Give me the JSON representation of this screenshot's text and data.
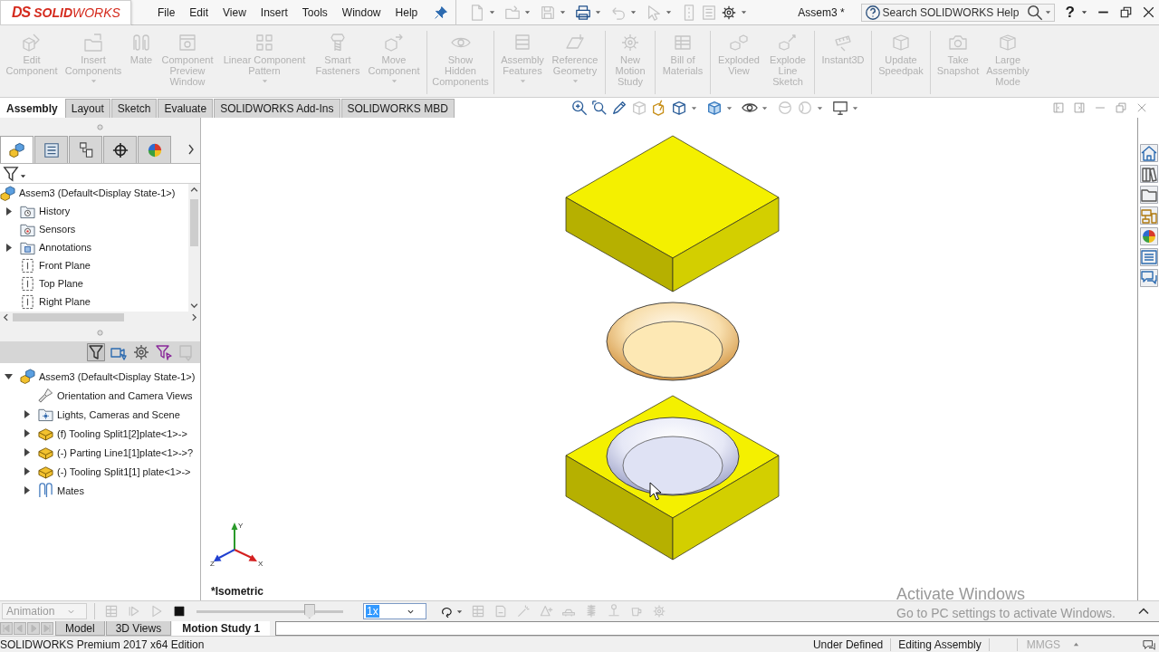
{
  "title_bar": {
    "logo_mark": "DS",
    "logo": "**SOLID**WORKS",
    "menu": [
      "File",
      "Edit",
      "View",
      "Insert",
      "Tools",
      "Window",
      "Help"
    ],
    "quick_access": [
      {
        "disabled": true
      },
      {
        "disabled": true
      },
      {
        "disabled": true
      },
      {
        "disabled": false
      },
      {
        "disabled": true
      },
      {
        "disabled": true
      },
      {
        "disabled": true
      },
      {
        "disabled": true
      },
      {
        "disabled": false
      }
    ],
    "document_title": "Assem3 *",
    "search": {
      "placeholder": "Search SOLIDWORKS Help"
    },
    "help_button": "?"
  },
  "command_manager": [
    {
      "buttons": [
        {
          "label": "Edit Component",
          "disabled": true,
          "dropdown": false
        },
        {
          "label": "Insert Components",
          "disabled": true,
          "dropdown": true
        },
        {
          "label": "Mate",
          "disabled": true,
          "dropdown": false
        },
        {
          "label": "Component Preview Window",
          "disabled": true,
          "dropdown": false
        },
        {
          "label": "Linear Component Pattern",
          "disabled": true,
          "dropdown": true
        },
        {
          "label": "Smart Fasteners",
          "disabled": true,
          "dropdown": false
        },
        {
          "label": "Move Component",
          "disabled": true,
          "dropdown": true
        }
      ]
    },
    {
      "buttons": [
        {
          "label": "Show Hidden Components",
          "disabled": true,
          "dropdown": false
        }
      ]
    },
    {
      "buttons": [
        {
          "label": "Assembly Features",
          "disabled": true,
          "dropdown": true
        },
        {
          "label": "Reference Geometry",
          "disabled": true,
          "dropdown": true
        }
      ]
    },
    {
      "buttons": [
        {
          "label": "New Motion Study",
          "disabled": true,
          "dropdown": false
        }
      ]
    },
    {
      "buttons": [
        {
          "label": "Bill of Materials",
          "disabled": true,
          "dropdown": false
        }
      ]
    },
    {
      "buttons": [
        {
          "label": "Exploded View",
          "disabled": true,
          "dropdown": false
        },
        {
          "label": "Explode Line Sketch",
          "disabled": true,
          "dropdown": false
        }
      ]
    },
    {
      "buttons": [
        {
          "label": "Instant3D",
          "disabled": true,
          "dropdown": false
        }
      ]
    },
    {
      "buttons": [
        {
          "label": "Update Speedpak",
          "disabled": true,
          "dropdown": false
        }
      ]
    },
    {
      "buttons": [
        {
          "label": "Take Snapshot",
          "disabled": true,
          "dropdown": false
        },
        {
          "label": "Large Assembly Mode",
          "disabled": true,
          "dropdown": false
        }
      ]
    }
  ],
  "command_tabs": [
    {
      "label": "Assembly",
      "selected": true
    },
    {
      "label": "Layout",
      "selected": false
    },
    {
      "label": "Sketch",
      "selected": false
    },
    {
      "label": "Evaluate",
      "selected": false
    },
    {
      "label": "SOLIDWORKS Add-Ins",
      "selected": false
    },
    {
      "label": "SOLIDWORKS MBD",
      "selected": false
    }
  ],
  "view_toolbar": [
    {
      "disabled": false
    },
    {
      "disabled": false
    },
    {
      "disabled": false
    },
    {
      "disabled": true
    },
    {
      "disabled": false
    },
    {
      "disabled": false
    },
    {
      "disabled": false
    },
    {
      "disabled": false
    },
    {
      "disabled": true
    },
    {
      "disabled": true
    },
    {
      "disabled": false
    }
  ],
  "panel_tabs": [
    {
      "selected": true
    },
    {
      "selected": false
    },
    {
      "selected": false
    },
    {
      "selected": false
    },
    {
      "selected": false
    }
  ],
  "feature_tree": {
    "root": {
      "label": "Assem3 (Default<Display State-1>)",
      "kind": "assembly",
      "expandable": false,
      "children": [
        {
          "label": "History",
          "kind": "history",
          "expandable": true,
          "expanded": false
        },
        {
          "label": "Sensors",
          "kind": "sensors",
          "expandable": false
        },
        {
          "label": "Annotations",
          "kind": "annotations",
          "expandable": true,
          "expanded": false
        },
        {
          "label": "Front Plane",
          "kind": "plane",
          "expandable": false
        },
        {
          "label": "Top Plane",
          "kind": "plane",
          "expandable": false
        },
        {
          "label": "Right Plane",
          "kind": "plane",
          "expandable": false
        }
      ]
    }
  },
  "tree_filters": [
    {
      "selected": true,
      "disabled": false
    },
    {
      "selected": false,
      "disabled": false
    },
    {
      "selected": false,
      "disabled": false
    },
    {
      "selected": false,
      "disabled": false
    },
    {
      "selected": false,
      "disabled": true
    }
  ],
  "display_tree": {
    "root": {
      "label": "Assem3 (Default<Display State-1>)",
      "kind": "assembly",
      "expandable": true,
      "expanded": true,
      "children": [
        {
          "label": "Orientation and Camera Views",
          "kind": "camera",
          "expandable": false
        },
        {
          "label": "Lights, Cameras and Scene",
          "kind": "lights",
          "expandable": true,
          "expanded": false
        },
        {
          "label": "(f) Tooling Split1[2]plate<1>->",
          "kind": "part",
          "expandable": true,
          "expanded": false
        },
        {
          "label": "(-) Parting Line1[1]plate<1>->?",
          "kind": "part",
          "expandable": true,
          "expanded": false
        },
        {
          "label": "(-) Tooling Split1[1] plate<1>->",
          "kind": "part",
          "expandable": true,
          "expanded": false
        },
        {
          "label": "Mates",
          "kind": "mates",
          "expandable": true,
          "expanded": false
        }
      ]
    }
  },
  "viewport": {
    "view_name": "*Isometric",
    "triad_labels": [
      "Y",
      "X",
      "Z"
    ]
  },
  "motion_manager": {
    "study_type": {
      "value": "Animation",
      "disabled": true
    },
    "playback_controls": [
      {
        "disabled": true
      },
      {
        "disabled": true
      },
      {
        "disabled": true
      },
      {
        "disabled": false
      }
    ],
    "timeline_slider": {
      "level": 0.77
    },
    "speed": {
      "value": "1x",
      "highlighted": true
    },
    "tools": [
      {
        "disabled": false
      },
      {
        "disabled": true
      },
      {
        "disabled": true
      },
      {
        "disabled": true
      },
      {
        "disabled": true
      },
      {
        "disabled": true
      },
      {
        "disabled": true
      },
      {
        "disabled": true
      },
      {
        "disabled": true
      },
      {
        "disabled": true
      }
    ]
  },
  "study_tabs": [
    {
      "label": "Model",
      "selected": false
    },
    {
      "label": "3D Views",
      "selected": false
    },
    {
      "label": "Motion Study 1",
      "selected": true
    }
  ],
  "status_bar": {
    "edition": "SOLIDWORKS Premium 2017 x64 Edition",
    "fields": [
      "Under Defined",
      "Editing Assembly"
    ],
    "units": "MMGS"
  },
  "os_notice": {
    "title": "Activate Windows",
    "message": "Go to PC settings to activate Windows."
  }
}
